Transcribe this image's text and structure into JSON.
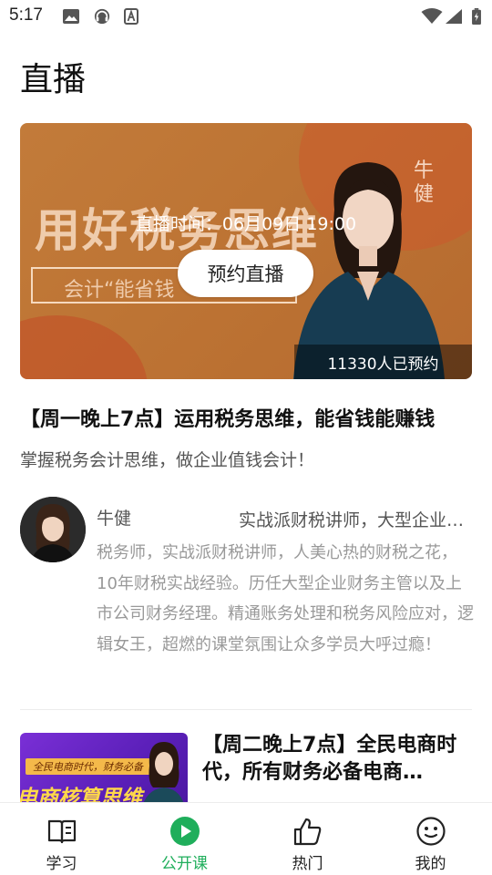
{
  "status_bar": {
    "time": "5:17"
  },
  "page": {
    "title": "直播"
  },
  "banner": {
    "live_time": "直播时间：06月09日 19:00",
    "reserve_button": "预约直播",
    "reserved_count": "11330人已预约",
    "image_text_main": "用好税务思维",
    "image_text_sub": "会计“能省钱",
    "image_text_side": "牛健"
  },
  "course": {
    "title": "【周一晚上7点】运用税务思维，能省钱能赚钱",
    "subtitle": "掌握税务会计思维，做企业值钱会计！"
  },
  "teacher": {
    "name": "牛健",
    "title": "实战派财税讲师，大型企业财务主管",
    "bio": "税务师，实战派财税讲师，人美心热的财税之花，10年财税实战经验。历任大型企业财务主管以及上市公司财务经理。精通账务处理和税务风险应对，逻辑女王，超燃的课堂氛围让众多学员大呼过瘾！"
  },
  "next_course": {
    "title": "【周二晚上7点】全民电商时代，所有财务必备电商…",
    "image_tag": "全民电商时代，财务必备",
    "image_text": "电商核算思维"
  },
  "bottom_nav": {
    "items": [
      {
        "label": "学习",
        "icon": "book-icon",
        "active": false
      },
      {
        "label": "公开课",
        "icon": "play-circle-icon",
        "active": true
      },
      {
        "label": "热门",
        "icon": "thumbs-up-icon",
        "active": false
      },
      {
        "label": "我的",
        "icon": "smiley-face-icon",
        "active": false
      }
    ]
  },
  "colors": {
    "accent_green": "#1fae5b",
    "banner_orange": "#bd7434",
    "text_gray": "#999999"
  }
}
